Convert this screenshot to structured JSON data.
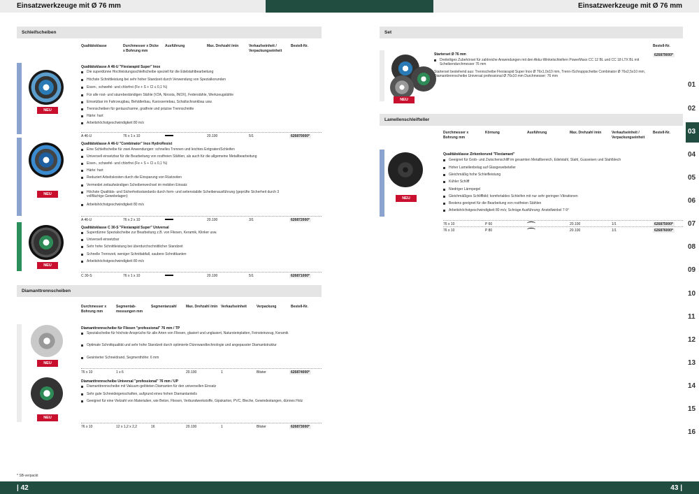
{
  "header": {
    "left_title": "Einsatzwerkzeuge mit Ø 76 mm",
    "right_title": "Einsatzwerkzeuge mit Ø 76 mm"
  },
  "footer": {
    "left_page": "| 42",
    "right_page": "43 |",
    "note": "* SB-verpackt"
  },
  "tabs": [
    "01",
    "02",
    "03",
    "04",
    "05",
    "06",
    "07",
    "08",
    "09",
    "10",
    "11",
    "12",
    "13",
    "14",
    "15",
    "16"
  ],
  "active_tab": "03",
  "badge": "NEU",
  "schleif": {
    "heading": "Schleifscheiben",
    "cols": [
      "Qualitätsklasse",
      "Durchmesser x Dicke x Bohrung mm",
      "Ausführung",
      "Max. Drehzahl /min",
      "Verkaufseinheit / Verpackungseinheit",
      "Bestell-Nr."
    ],
    "products": [
      {
        "title": "Qualitätsklasse A 46-U \"Flexiarapid Super\" Inox",
        "bullets": [
          "Die superdünne Hochleistungsschleifscheibe speziell für die Edelstahlbearbeitung",
          "Höchste Schnittleistung bei sehr hoher Standzeit durch Verwendung von Spezialkorunden",
          "Eisen-, schwefel- und chlorfrei (Fe + S + Cl ≤ 0,1 %)",
          "Für alle rost- und säurebeständigen Stähle (V2A, Nirosta, INOX), Federstähle, Werkzeugstähle",
          "Einsetzbar im Fahrzeugbau, Behälterbau, Karosseriebau, Schaltschrankbau usw.",
          "Trennscheiben für geräuscharme, gratfreie und präzise Trennschnitte",
          "Härte: hart",
          "Arbeitshöchstgeschwindigkeit 80 m/s"
        ],
        "row": {
          "klasse": "A 46-U",
          "dim": "76 x 1 x 10",
          "rpm": "20.100",
          "vpe": "5/1",
          "order": "626870000*"
        }
      },
      {
        "title": "Qualitätsklasse A 46-U \"Combinator\" Inox HydroResist",
        "bullets": [
          "Eine Schleifscheibe für zwei Anwendungen: schnelles Trennen und leichtes Entgraten/Schleifen",
          "Universell einsetzbar für die Bearbeitung von rostfreien Stählen, als auch für die allgemeine Metallbearbeitung",
          "Eisen-, schwefel- und chlorfrei (Fe + S + Cl ≤ 0,1 %)",
          "Härte: hart",
          "Reduziert Arbeitskosten durch die Einsparung von Rüstzeiten",
          "Vermeidet zeitaufwändigen Scheibenwechsel im mobilen Einsatz",
          "Höchste Qualitäts- und Sicherheitsstandards durch form- und seitenstabile Scheibenausführung (geprüfte Sicherheit durch 3 vollflächige Gewebelagen)",
          "Arbeitshöchstgeschwindigkeit 80 m/s"
        ],
        "row": {
          "klasse": "A 46-U",
          "dim": "76 x 2 x 10",
          "rpm": "20.100",
          "vpe": "3/1",
          "order": "626872000*"
        }
      },
      {
        "title": "Qualitätsklasse C 30-S \"Flexiarapid Super\" Universal",
        "bullets": [
          "Superdünne Spezialscheibe zur Bearbeitung z.B. von Fliesen, Keramik, Klinker usw.",
          "Universell einsetzbar",
          "Sehr hohe Schnittleistung bei überdurchschnittlicher Standzeit",
          "Schnelle Trennzeit, weniger Schnittabfall, saubere Schnittkanten",
          "Arbeitshöchstgeschwindigkeit 80 m/s"
        ],
        "row": {
          "klasse": "C 30-S",
          "dim": "76 x 1 x 10",
          "rpm": "20.100",
          "vpe": "5/1",
          "order": "626871000*"
        }
      }
    ]
  },
  "diamant": {
    "heading": "Diamanttrennscheiben",
    "cols": [
      "Durchmesser x Bohrung mm",
      "Segmentab- messungen mm",
      "Segmentanzahl",
      "Max. Drehzahl /min",
      "Verkaufseinheit",
      "Verpackung",
      "Bestell-Nr."
    ],
    "products": [
      {
        "title": "Diamanttrennscheibe für Fliesen \"professional\" 76 mm / TP",
        "bullets": [
          "Spezialscheibe für höchste Ansprüche für alle Arten von Fliesen, glasiert und unglasiert, Natursteinplatten, Feinsteinzeug, Keramik",
          "Optimale Schnittqualität und sehr hohe Standzeit durch optimierte Dünnwandtechnologie und angepasster Diamantstruktur",
          "Gesinterter Schneidrand, Segmenthöhe: 6 mm"
        ],
        "row": {
          "dim": "76 x 10",
          "seg": "1 x 6",
          "anz": "",
          "rpm": "20.100",
          "vpe": "1",
          "pack": "Blister",
          "order": "626874000*"
        }
      },
      {
        "title": "Diamanttrennscheibe Universal \"professional\" 76 mm / UP",
        "bullets": [
          "Diamanttrennscheibe mit Vakuum-gelöteten Diamanten für den universellen Einsatz",
          "Sehr gute Schneideigenschaften, aufgrund eines hohen Diamantanteils",
          "Geeignet für eine Vielzahl von Materialien, wie Beton, Fliesen, Verbundwerkstoffe, Gipskarton, PVC, Bleche, Gewindestangen, dünnes Holz"
        ],
        "row": {
          "dim": "76 x 10",
          "seg": "12 x 1,2 x 2,2",
          "anz": "16",
          "rpm": "20.100",
          "vpe": "1",
          "pack": "Blister",
          "order": "626873000*"
        }
      }
    ]
  },
  "set": {
    "heading": "Set",
    "col": "Bestell-Nr.",
    "title": "Starterset Ø 76 mm",
    "bullet": "Dreiteiliges Zubehörset für zahlreiche Anwendungen mit den Akku-Winkelschleifern PowerMaxx CC 12 BL und CC 18 LTX BL mit Scheibendurchmesser 76 mm",
    "text": "Starterset bestehend aus: Trennscheibe Flexiarapid Super Inox Ø 76x1,0x10 mm, Trenn-/Schruppscheibe Combinator Ø 76x2,5x10 mm, Diamanttrennscheibe Universal professional Ø 76x10 mm Durchmesser: 76 mm",
    "order": "626879000*"
  },
  "lamellen": {
    "heading": "Lamellenschleifteller",
    "cols": [
      "Durchmesser x Bohrung mm",
      "Körnung",
      "Ausführung",
      "Max. Drehzahl /min",
      "Verkaufseinheit / Verpackungseinheit",
      "Bestell-Nr."
    ],
    "title": "Qualitätsklasse Zirkonkorund \"Flexiamant\"",
    "bullets": [
      "Geeignet für Grob- und Zwischenschliff im gesamten Metallbereich, Edelstahl, Stahl, Gusseisen und Stahlblech",
      "Hoher Lamellenbelag auf Glasgewebeteller",
      "Gleichmäßig hohe Schleifleistung",
      "Kühler Schliff",
      "Niedriger Lärmpegel",
      "Gleichmäßiges Schliffbild; komfortables Schleifen mit nur sehr geringen Vibrationen",
      "Bestens geeignet für die Bearbeitung von rostfreien Stählen",
      "Arbeitshöchstgeschwindigkeit 80 m/s; Schräge Ausführung: Anstellwinkel 7-9°"
    ],
    "rows": [
      {
        "dim": "76 x 10",
        "grit": "P 60",
        "rpm": "20.100",
        "vpe": "1/1",
        "order": "626875000*"
      },
      {
        "dim": "76 x 10",
        "grit": "P 80",
        "rpm": "20.100",
        "vpe": "1/1",
        "order": "626876000*"
      }
    ]
  }
}
